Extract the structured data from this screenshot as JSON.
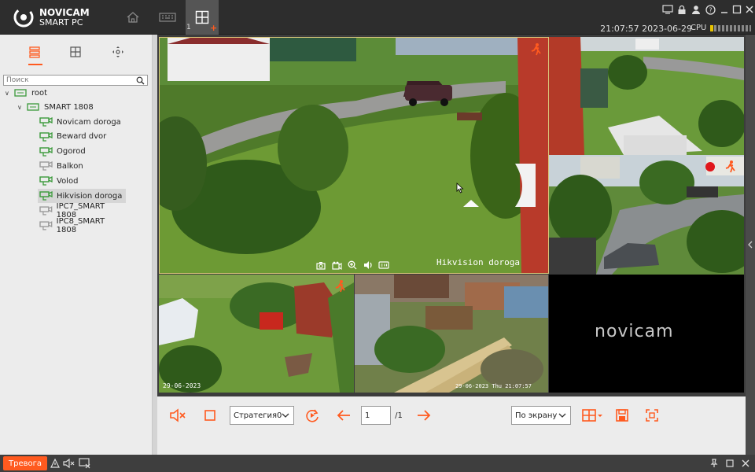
{
  "app": {
    "brand_line1": "NOVICAM",
    "brand_line2": "SMART PC",
    "layout_tab_number": "1",
    "layout_tab_add": "+"
  },
  "status": {
    "datetime": "21:07:57 2023-06-29",
    "cpu_label": "CPU"
  },
  "colors": {
    "accent": "#ff5a1f",
    "titlebar": "#2d2d2d",
    "panel": "#ececec",
    "active_cell_border": "#d9c67a",
    "camera_icon_green": "#3a9a3a"
  },
  "sidebar": {
    "search_placeholder": "Поиск",
    "tabs": [
      "device-tree-icon",
      "layout-grid-icon",
      "ptz-control-icon"
    ],
    "tree": {
      "root": "root",
      "group": "SMART 1808",
      "cameras": [
        {
          "label": "Novicam doroga",
          "online": true
        },
        {
          "label": "Beward dvor",
          "online": true
        },
        {
          "label": "Ogorod",
          "online": true
        },
        {
          "label": "Balkon",
          "online": false
        },
        {
          "label": "Volod",
          "online": true
        },
        {
          "label": "Hikvision doroga",
          "online": true,
          "selected": true
        },
        {
          "label": "IPC7_SMART 1808",
          "online": false
        },
        {
          "label": "IPC8_SMART 1808",
          "online": false
        }
      ]
    }
  },
  "video": {
    "main_cell_label": "Hikvision doroga",
    "bl_timestamp": "29-06-2023",
    "bm_timestamp": "29-06-2023 Thu 21:07:57",
    "logo_text": "novicam",
    "cell_toolbar_icons": [
      "snapshot-icon",
      "record-icon",
      "zoom-icon",
      "audio-icon",
      "stream-icon"
    ]
  },
  "controls": {
    "strategy_select": "Стратегия0",
    "page_current": "1",
    "page_total": "/1",
    "fit_select": "По экрану"
  },
  "statusbar": {
    "alarm_label": "Тревога"
  }
}
